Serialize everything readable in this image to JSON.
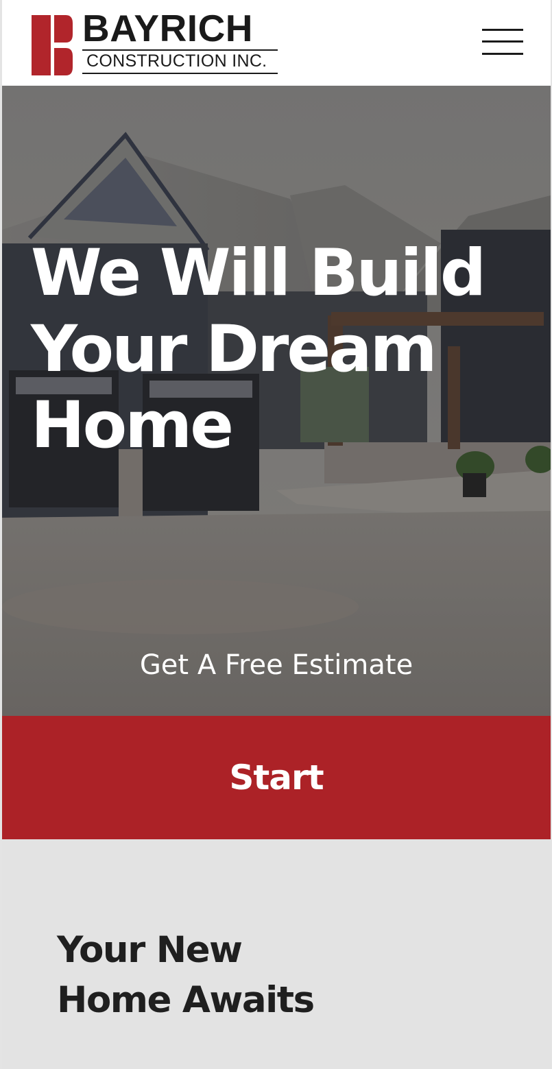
{
  "header": {
    "logo": {
      "wordmark": "BAYRICH",
      "subtitle": "CONSTRUCTION INC.",
      "brand_color": "#b1252b"
    },
    "menu_icon": "hamburger-menu-icon"
  },
  "hero": {
    "title_lines": [
      "We Will Build",
      "Your Dream",
      "Home"
    ],
    "estimate_link": "Get A Free Estimate",
    "start_button": "Start",
    "button_color": "#ac2227"
  },
  "section": {
    "title_lines": [
      "Your New",
      "Home Awaits"
    ],
    "background": "#e3e3e3"
  }
}
